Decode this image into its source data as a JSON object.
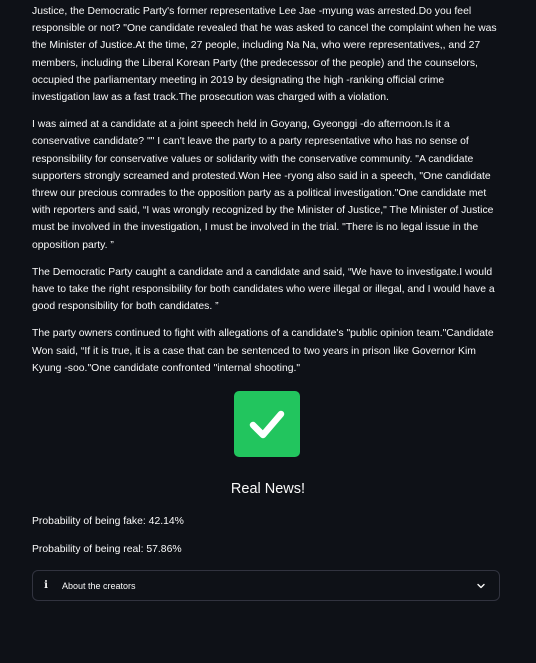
{
  "article": {
    "paragraphs": [
      "Justice, the Democratic Party's former representative Lee Jae -myung was arrested.Do you feel responsible or not? \"One candidate revealed that he was asked to cancel the complaint when he was the Minister of Justice.At the time, 27 people, including Na Na, who were representatives,, and 27 members, including the Liberal Korean Party (the predecessor of the people) and the counselors, occupied the parliamentary meeting in 2019 by designating the high -ranking official crime investigation law as a fast track.The prosecution was charged with a violation.",
      "I was aimed at a candidate at a joint speech held in Goyang, Gyeonggi -do afternoon.Is it a conservative candidate? \"\" I can't leave the party to a party representative who has no sense of responsibility for conservative values or solidarity with the conservative community. \"A candidate supporters strongly screamed and protested.Won Hee -ryong also said in a speech, \"One candidate threw our precious comrades to the opposition party as a political investigation.\"One candidate met with reporters and said, “I was wrongly recognized by the Minister of Justice,\" The Minister of Justice must be involved in the investigation, I must be involved in the trial. \"There is no legal issue in the opposition party. ”",
      "The Democratic Party caught a candidate and a candidate and said, “We have to investigate.I would have to take the right responsibility for both candidates who were illegal or illegal, and I would have a good responsibility for both candidates. ”",
      "The party owners continued to fight with allegations of a candidate's \"public opinion team.\"Candidate Won said, “If it is true, it is a case that can be sentenced to two years in prison like Governor Kim Kyung -soo.\"One candidate confronted \"internal shooting.\""
    ]
  },
  "result": {
    "icon": "check-mark-icon",
    "icon_color": "#22c55e",
    "verdict": "Real News!",
    "prob_fake": "Probability of being fake: 42.14%",
    "prob_real": "Probability of being real: 57.86%"
  },
  "expander": {
    "icon": "info-icon",
    "label": "About the creators",
    "chevron": "chevron-down-icon"
  },
  "theme": {
    "background": "#0e1117",
    "text": "#fafafa",
    "border": "#31333f"
  }
}
